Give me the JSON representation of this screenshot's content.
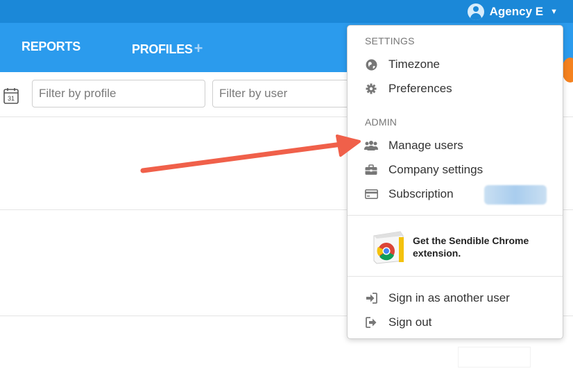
{
  "header": {
    "account_name": "Agency E"
  },
  "nav": {
    "reports_label": "REPORTS",
    "profiles_label": "PROFILES",
    "profiles_plus": "+"
  },
  "filters": {
    "calendar_day": "31",
    "profile_placeholder": "Filter by profile",
    "user_placeholder": "Filter by user"
  },
  "menu": {
    "settings_heading": "SETTINGS",
    "timezone_label": "Timezone",
    "preferences_label": "Preferences",
    "admin_heading": "ADMIN",
    "manage_users_label": "Manage users",
    "company_settings_label": "Company settings",
    "subscription_label": "Subscription",
    "promo_text": "Get the Sendible Chrome extension.",
    "sign_in_other_label": "Sign in as another user",
    "sign_out_label": "Sign out"
  },
  "colors": {
    "topbar": "#1b88d8",
    "navbar": "#2b9bed",
    "annotation_arrow": "#f0604a",
    "accent_orange": "#f5821f"
  },
  "icons": {
    "timezone": "globe-icon",
    "preferences": "gear-icon",
    "manage_users": "users-icon",
    "company_settings": "briefcase-icon",
    "subscription": "credit-card-icon",
    "sign_in_other": "sign-in-icon",
    "sign_out": "sign-out-icon"
  }
}
